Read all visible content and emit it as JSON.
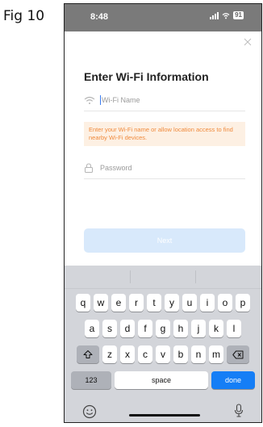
{
  "figure_label": "Fig 10",
  "status_bar": {
    "time": "8:48",
    "battery": "91"
  },
  "dialog": {
    "title": "Enter Wi-Fi Information",
    "wifi_placeholder": "Wi-Fi Name",
    "notice": "Enter your Wi-Fi name or allow location access to find nearby Wi-Fi devices.",
    "password_placeholder": "Password",
    "next_label": "Next"
  },
  "keyboard": {
    "row1": [
      "q",
      "w",
      "e",
      "r",
      "t",
      "y",
      "u",
      "i",
      "o",
      "p"
    ],
    "row2": [
      "a",
      "s",
      "d",
      "f",
      "g",
      "h",
      "j",
      "k",
      "l"
    ],
    "row3": [
      "z",
      "x",
      "c",
      "v",
      "b",
      "n",
      "m"
    ],
    "numbers_label": "123",
    "space_label": "space",
    "done_label": "done"
  },
  "icons": [
    "close-icon",
    "wifi-icon",
    "lock-icon",
    "shift-icon",
    "backspace-icon",
    "emoji-icon",
    "microphone-icon"
  ],
  "colors": {
    "accent": "#157ef6",
    "notice_text": "#f08a3c",
    "notice_bg": "#fdf0e3",
    "next_disabled": "#d8e9fb"
  }
}
